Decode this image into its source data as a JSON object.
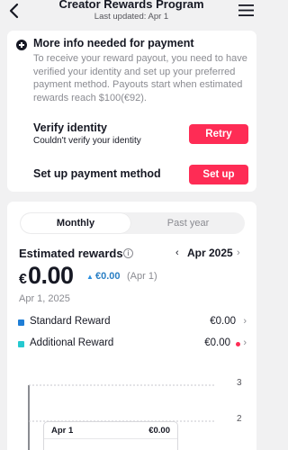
{
  "header": {
    "title": "Creator Rewards Program",
    "subtitle": "Last updated: Apr 1"
  },
  "notice": {
    "title": "More info needed for payment",
    "body": "To receive your reward payout, you need to have verified your identity and set up your preferred payment method. Payouts start when estimated rewards reach $100(€92).",
    "verify": {
      "title": "Verify identity",
      "status": "Couldn't verify your identity",
      "button": "Retry"
    },
    "payment": {
      "title": "Set up payment method",
      "button": "Set up"
    }
  },
  "rewards": {
    "tabs": [
      "Monthly",
      "Past year"
    ],
    "selected_tab": "Monthly",
    "title": "Estimated rewards",
    "month": "Apr 2025",
    "currency_symbol": "€",
    "amount": "0.00",
    "change": "€0.00",
    "change_date": "(Apr 1)",
    "date": "Apr 1, 2025",
    "breakdown": [
      {
        "label": "Standard Reward",
        "value": "€0.00",
        "color": "#1f7ed6"
      },
      {
        "label": "Additional Reward",
        "value": "€0.00",
        "color": "#25c9d0",
        "alert": true
      }
    ]
  },
  "chart_data": {
    "type": "line",
    "y_ticks": [
      "3",
      "2"
    ],
    "tooltip": {
      "date": "Apr 1",
      "value": "€0.00"
    }
  },
  "colors": {
    "accent": "#fe2c55",
    "positive": "#2a7fc4",
    "background": "#f1f1f2"
  }
}
